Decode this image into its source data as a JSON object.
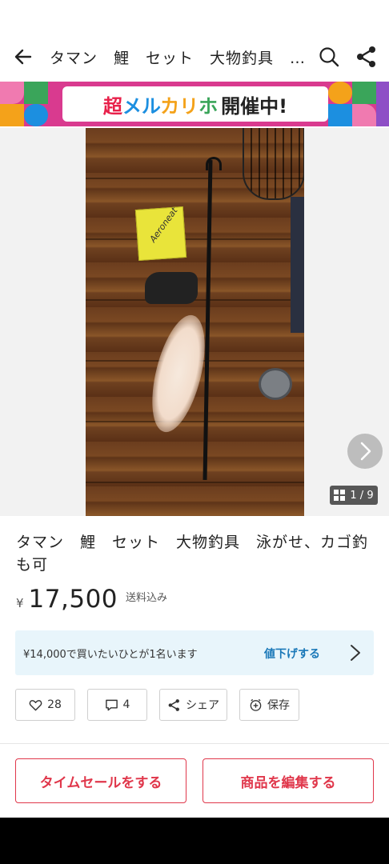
{
  "header": {
    "title": "タマン　鯉　セット　大物釣具　…",
    "back_icon": "arrow-left-icon",
    "search_icon": "search-icon",
    "share_icon": "share-icon"
  },
  "banner": {
    "logo_part1": "超",
    "logo_part2": "メル",
    "logo_part3": "カリ",
    "logo_part4": "ホ",
    "event_text": "開催中!"
  },
  "gallery": {
    "counter": "1 / 9",
    "next_icon": "chevron-right-icon",
    "photo_box_text": "Aeroneat"
  },
  "item": {
    "title": "タマン　鯉　セット　大物釣具　泳がせ、カゴ釣も可",
    "currency": "¥",
    "price": "17,500",
    "shipping": "送料込み"
  },
  "offer": {
    "message": "¥14,000で買いたいひとが1名います",
    "action": "値下げする"
  },
  "chips": {
    "likes": "28",
    "comments": "4",
    "share": "シェア",
    "save": "保存"
  },
  "actions": {
    "time_sale": "タイムセールをする",
    "edit_item": "商品を編集する"
  },
  "colors": {
    "accent_red": "#e0374b",
    "link_blue": "#1a78b8",
    "offer_bg": "#e8f5fb"
  }
}
